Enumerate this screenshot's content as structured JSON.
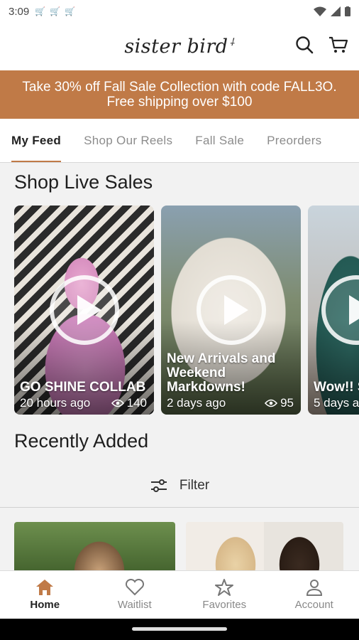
{
  "status_bar": {
    "time": "3:09"
  },
  "header": {
    "logo_text": "sister bird"
  },
  "promo": {
    "line1": "Take 30% off Fall Sale Collection with code FALL3O.",
    "line2": "Free shipping over $100",
    "color": "#c07a47"
  },
  "tabs": [
    {
      "label": "My Feed",
      "active": true
    },
    {
      "label": "Shop Our Reels"
    },
    {
      "label": "Fall Sale"
    },
    {
      "label": "Preorders"
    }
  ],
  "live_sales": {
    "title": "Shop Live Sales",
    "cards": [
      {
        "title": "GO SHINE COLLAB",
        "time": "20 hours ago",
        "views": "140"
      },
      {
        "title": "New Arrivals and Weekend Markdowns!",
        "time": "2 days ago",
        "views": "95"
      },
      {
        "title": "Wow!! S",
        "time": "5 days a",
        "views": ""
      }
    ]
  },
  "recently_added": {
    "title": "Recently Added",
    "filter_label": "Filter"
  },
  "bottom_nav": [
    {
      "label": "Home",
      "icon": "home-icon",
      "active": true
    },
    {
      "label": "Waitlist",
      "icon": "heart-icon"
    },
    {
      "label": "Favorites",
      "icon": "star-icon"
    },
    {
      "label": "Account",
      "icon": "account-icon"
    }
  ]
}
